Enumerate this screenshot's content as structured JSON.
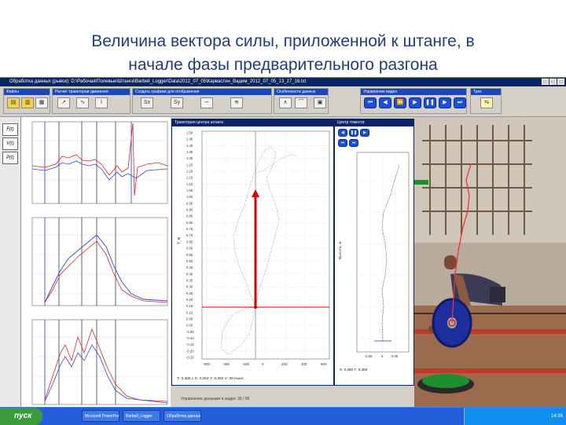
{
  "slide": {
    "title_line1": "Величина вектора силы, приложенной к штанге, в",
    "title_line2": "начале фазы предварительного разгона"
  },
  "window": {
    "title": "Обработка данных (рывок): D:\\Рабочая\\Полевые\\Штанга\\Barbell_Logger\\Data\\2012_07_05\\Карвастин_Вадим_2012_07_05_13_27_16.txt"
  },
  "toolbar": {
    "groups": [
      {
        "label": "Файлы"
      },
      {
        "label": "Расчет траектории движения"
      },
      {
        "label": "Создать графики для отображения"
      },
      {
        "label": "Особенности данных"
      },
      {
        "label": "Управление видео"
      },
      {
        "label": "Трек"
      }
    ]
  },
  "left_buttons": [
    "F(t)",
    "V(t)",
    "P(t)"
  ],
  "trajectory_window": {
    "title": "Траектория центра штанги",
    "y_ticks": [
      "1.50",
      "1.45",
      "1.40",
      "1.35",
      "1.30",
      "1.25",
      "1.20",
      "1.15",
      "1.10",
      "1.05",
      "1.00",
      "0.95",
      "0.90",
      "0.85",
      "0.80",
      "0.75",
      "0.70",
      "0.65",
      "0.60",
      "0.55",
      "0.50",
      "0.45",
      "0.40",
      "0.35",
      "0.30",
      "0.25",
      "0.20",
      "0.15",
      "0.10",
      "0.05",
      "0.00",
      "-0.05",
      "-0.10",
      "-0.15",
      "-0.20",
      "-0.25"
    ],
    "x_ticks": [
      "-600",
      "-400",
      "-200",
      "0",
      "200",
      "400",
      "600"
    ],
    "ylabel": "Y, м",
    "readout": "Т: 0,380 с   Х: 0,004   Y: 0,060   V: 00 Ньют."
  },
  "vert_window": {
    "title": "Центр тяжести",
    "ylabel": "Высота, м",
    "x_ticks": [
      "-0.05",
      "0",
      "0.05"
    ],
    "readout": "Х: 0,060   Т: 0,380"
  },
  "taskbar": {
    "start": "пуск",
    "tasks": [
      "Microsoft PowerPoint",
      "Barbell_Logger",
      "Обработка данных"
    ],
    "clock": "14:35"
  },
  "statusbar": "Управление данными в кадре: 35 / 58"
}
